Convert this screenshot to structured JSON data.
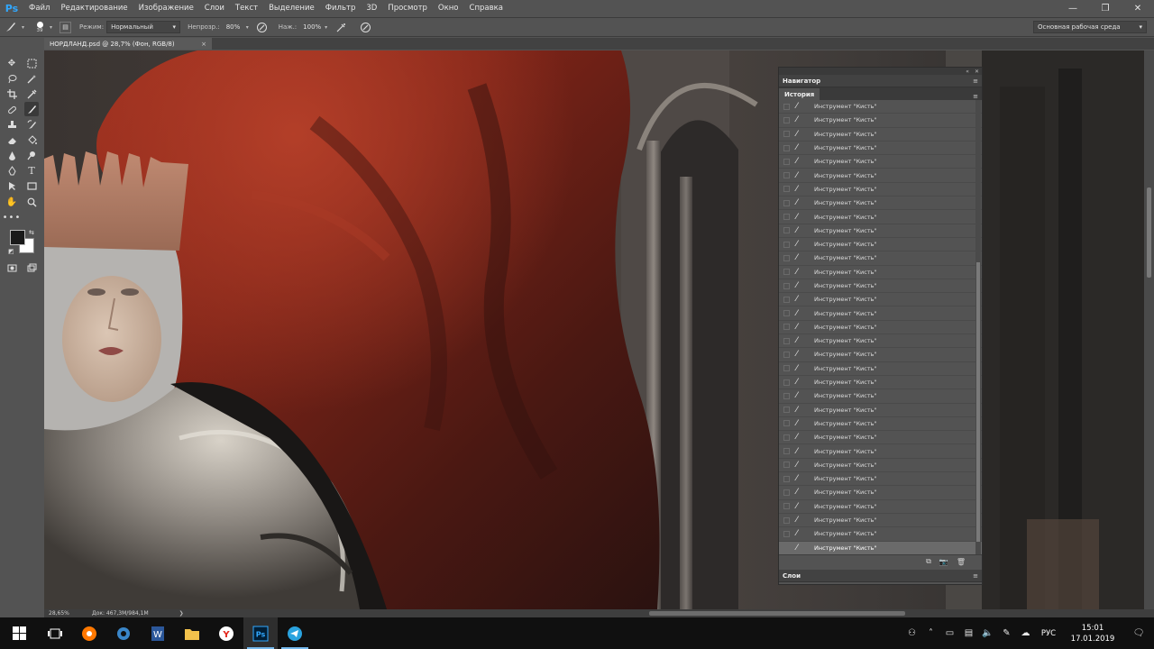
{
  "app": {
    "logo": "Ps",
    "menu": [
      "Файл",
      "Редактирование",
      "Изображение",
      "Слои",
      "Текст",
      "Выделение",
      "Фильтр",
      "3D",
      "Просмотр",
      "Окно",
      "Справка"
    ]
  },
  "options": {
    "brush_size": "39",
    "mode_label": "Режим:",
    "mode_value": "Нормальный",
    "opacity_label": "Непрозр.:",
    "opacity_value": "80%",
    "flow_label": "Наж.:",
    "flow_value": "100%",
    "workspace": "Основная рабочая среда"
  },
  "document": {
    "tab_title": "НОРДЛАНД.psd @ 28,7% (Фон, RGB/8)",
    "zoom": "28,65%",
    "doc_info": "Док: 467,3M/984,1M"
  },
  "panel": {
    "navigator_title": "Навигатор",
    "history_title": "История",
    "history_item": "Инструмент \"Кисть\"",
    "history_count": 33,
    "layers_title": "Слои"
  },
  "taskbar": {
    "lang": "РУС",
    "time": "15:01",
    "date": "17.01.2019"
  },
  "colors": {
    "accent": "#31a8ff",
    "foreground": "#1a1a1a",
    "background": "#ffffff"
  }
}
